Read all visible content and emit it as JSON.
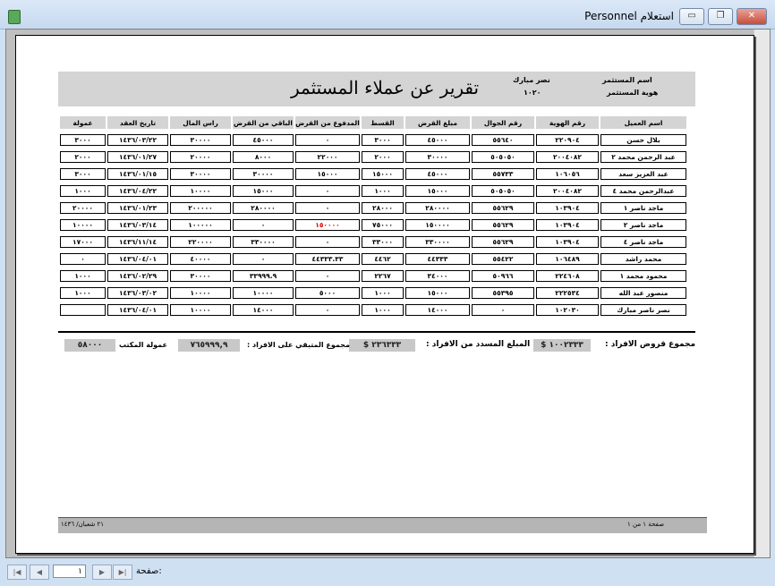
{
  "window": {
    "title": "Personnel استعلام",
    "minimize_label": "▭",
    "restore_label": "❐",
    "close_label": "✕"
  },
  "report": {
    "title": "تقرير عن عملاء المستثمر",
    "investor_name_label": "اسم المستثمر",
    "investor_id_label": "هوية المستثمر",
    "investor_name_value": "نصر مبارك",
    "investor_id_value": "١٠٢٠"
  },
  "table": {
    "columns": [
      "اسم العميل",
      "رقم الهوية",
      "رقم الجوال",
      "مبلغ القرض",
      "القسط",
      "المدفوع من القرض",
      "الباقي من القرض",
      "راس المال",
      "تاريخ العقد",
      "عمولة"
    ],
    "rows": [
      [
        "بلال حسن",
        "٢٢٠٩٠٤",
        "٥٥٦٤٠",
        "٤٥٠٠٠",
        "٣٠٠٠",
        "٠",
        "٤٥٠٠٠",
        "٣٠٠٠٠",
        "١٤٣٦/٠٣/٢٢",
        "٣٠٠٠"
      ],
      [
        "عبد الرحمن محمد ٢",
        "٢٠٠٤٠٨٢",
        "٥٠٥٠٥٠",
        "٣٠٠٠٠",
        "٢٠٠٠",
        "٢٢٠٠٠",
        "٨٠٠٠",
        "٢٠٠٠٠",
        "١٤٣٦/٠١/٢٧",
        "٢٠٠٠"
      ],
      [
        "عبد العزيز سعد",
        "١٠٦٠٥٦",
        "٥٥٧٣٣",
        "٤٥٠٠٠",
        "١٥٠٠٠",
        "١٥٠٠٠",
        "٣٠٠٠٠",
        "٣٠٠٠٠",
        "١٤٣٦/٠١/١٥",
        "٣٠٠٠"
      ],
      [
        "عبدالرحمن محمد ٤",
        "٢٠٠٤٠٨٢",
        "٥٠٥٠٥٠",
        "١٥٠٠٠",
        "١٠٠٠",
        "٠",
        "١٥٠٠٠",
        "١٠٠٠٠",
        "١٤٣٦/٠٤/٢٢",
        "١٠٠٠"
      ],
      [
        "ماجد ناصر ١",
        "١٠٣٩٠٤",
        "٥٥٦٢٩",
        "٢٨٠٠٠٠",
        "٢٨٠٠٠",
        "٠",
        "٢٨٠٠٠٠",
        "٢٠٠٠٠٠",
        "١٤٣٦/٠١/٢٣",
        "٢٠٠٠٠"
      ],
      [
        "ماجد ناصر ٢",
        "١٠٣٩٠٤",
        "٥٥٦٢٩",
        "١٥٠٠٠٠",
        "٧٥٠٠٠",
        "١٥٠٠٠٠",
        "٠",
        "١٠٠٠٠٠",
        "١٤٣٦/٠٣/١٤",
        "١٠٠٠٠"
      ],
      [
        "ماجد ناصر ٤",
        "١٠٣٩٠٤",
        "٥٥٦٢٩",
        "٣٣٠٠٠٠",
        "٣٣٠٠٠",
        "٠",
        "٣٣٠٠٠٠",
        "٢٢٠٠٠٠",
        "١٤٣٦/١١/١٤",
        "١٧٠٠٠"
      ],
      [
        "محمد راشد",
        "١٠٦٤٨٩",
        "٥٥٤٢٢",
        "٤٤٣٣٣",
        "٤٤٦٢",
        "٤٤٣٣٣.٣٣",
        "٠",
        "٤٠٠٠٠",
        "١٤٣٦/٠٤/٠١",
        "٠"
      ],
      [
        "محمود محمد ١",
        "٢٢٤٦٠٨",
        "٥٠٩٦٦",
        "٣٤٠٠٠",
        "٢٢٦٧",
        "٠",
        "٣٣٩٩٩.٩",
        "٣٠٠٠٠",
        "١٤٣٦/٠٢/٢٩",
        "١٠٠٠"
      ],
      [
        "منصور عبد الله",
        "٢٢٢٥٣٤",
        "٥٥٣٩٥",
        "١٥٠٠٠",
        "١٠٠٠",
        "٥٠٠٠",
        "١٠٠٠٠",
        "١٠٠٠٠",
        "١٤٣٦/٠٣/٠٢",
        "١٠٠٠"
      ],
      [
        "نصر ناصر مبارك",
        "١٠٢٠٣٠",
        "٠",
        "١٤٠٠٠",
        "١٠٠٠",
        "٠",
        "١٤٠٠٠",
        "١٠٠٠٠",
        "١٤٣٦/٠٤/٠١",
        ""
      ]
    ]
  },
  "summary": {
    "total_loans_label": "مجموع قروض الافراد :",
    "total_loans_value": "١٠٠٢٣٣٣",
    "paid_label": "المبلغ المسدد من الافراد :",
    "paid_value": "٢٣٦٣٣٣",
    "remaining_label": "مجموع المتبقي على الافراد :",
    "remaining_value": "٧٦٥٩٩٩,٩",
    "office_commission_label": "عمولة المكتب",
    "office_commission_value": "٥٨٠٠٠",
    "currency_symbol": "$"
  },
  "footer": {
    "page_of": "صفحة ١ من ١",
    "date": "٢١ شعبان/ ١٤٣٦"
  },
  "nav": {
    "page_label": "صفحة:",
    "page_value": "١",
    "first_label": "|◀",
    "prev_label": "◀",
    "next_label": "▶",
    "last_label": "▶|"
  },
  "colors": {
    "highlight_red": "#e00000"
  }
}
